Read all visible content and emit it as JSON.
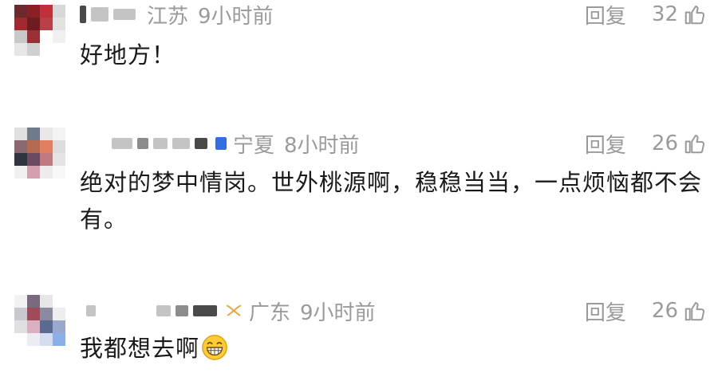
{
  "comments": [
    {
      "location": "江苏",
      "time": "9小时前",
      "reply_label": "回复",
      "likes": "32",
      "text": "好地方！"
    },
    {
      "location": "宁夏",
      "time": "8小时前",
      "reply_label": "回复",
      "likes": "26",
      "text": "绝对的梦中情岗。世外桃源啊，稳稳当当，一点烦恼都不会有。"
    },
    {
      "location": "广东",
      "time": "9小时前",
      "reply_label": "回复",
      "likes": "26",
      "text": "我都想去啊"
    }
  ],
  "colors": {
    "meta_gray": "#9a9a9a",
    "text": "#1a1a1a",
    "badge_blue": "#2f6fe0",
    "bow_orange": "#f0a030"
  },
  "icons": [
    "thumb-up-icon",
    "grin-emoji-icon",
    "verified-badge-icon",
    "bow-decoration-icon"
  ]
}
